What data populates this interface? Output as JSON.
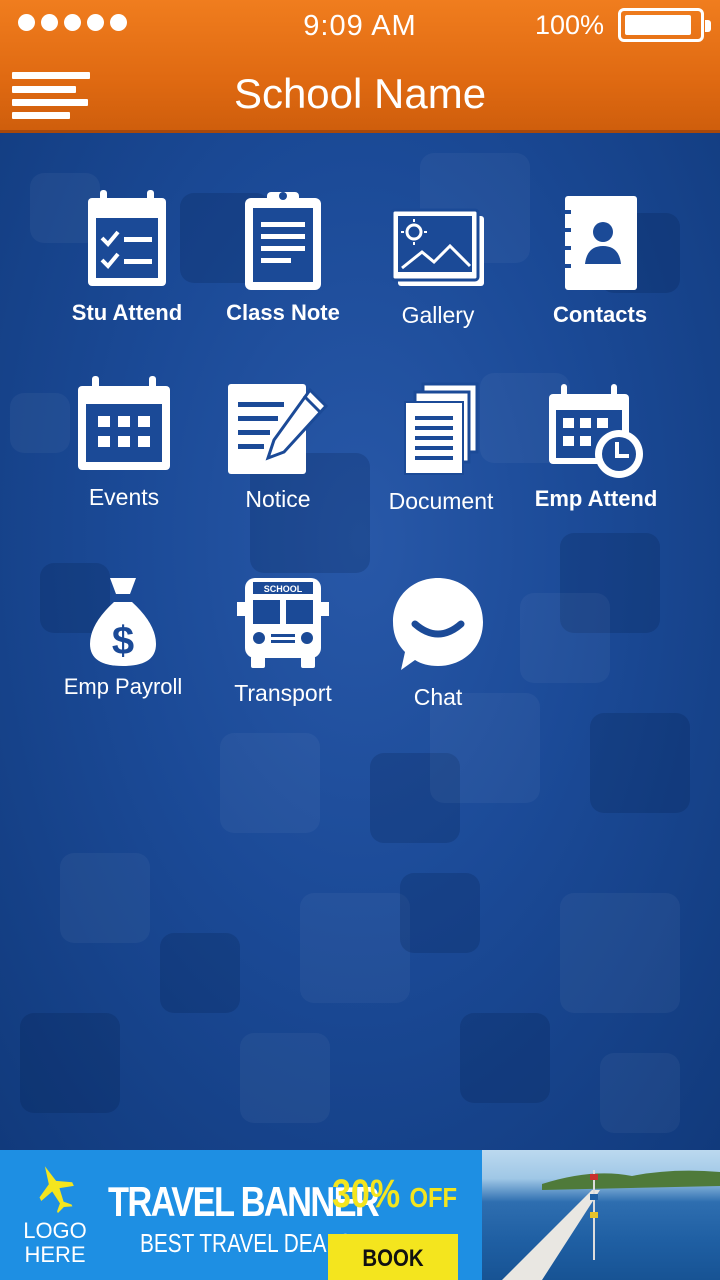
{
  "status_bar": {
    "time": "9:09 AM",
    "battery": "100%"
  },
  "header": {
    "title": "School Name"
  },
  "tiles": [
    {
      "label": "Stu Attend"
    },
    {
      "label": "Class Note"
    },
    {
      "label": "Gallery"
    },
    {
      "label": "Contacts"
    },
    {
      "label": "Events"
    },
    {
      "label": "Notice"
    },
    {
      "label": "Document"
    },
    {
      "label": "Emp Attend"
    },
    {
      "label": "Emp Payroll"
    },
    {
      "label": "Transport"
    },
    {
      "label": "Chat"
    }
  ],
  "bus_sign": "SCHOOL",
  "banner": {
    "logo_line1": "LOGO",
    "logo_line2": "HERE",
    "title": "TRAVEL BANNER",
    "subtitle": "BEST TRAVEL DEALS",
    "discount": "30%",
    "discount_suffix": "OFF",
    "cta": "BOOK NOW"
  },
  "colors": {
    "header": "#f07d1e",
    "background": "#1b4a97",
    "banner": "#1e8fe3",
    "promo": "#f4e51e"
  }
}
